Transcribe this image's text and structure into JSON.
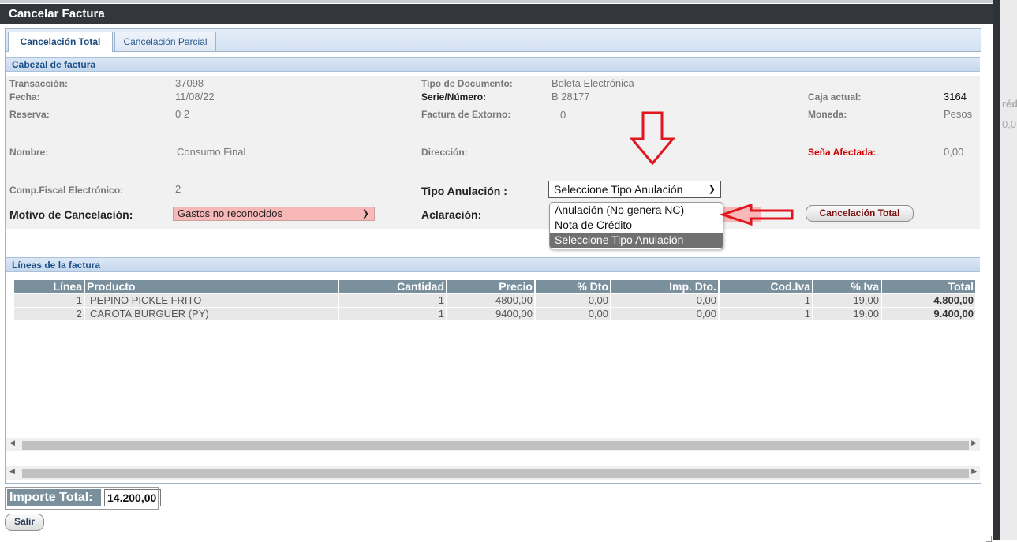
{
  "window": {
    "title": "Cancelar Factura"
  },
  "background": {
    "ghost_text_1": "réd",
    "ghost_text_2": "0,0"
  },
  "tabs": [
    {
      "label": "Cancelación Total",
      "active": true
    },
    {
      "label": "Cancelación Parcial",
      "active": false
    }
  ],
  "header_section": {
    "title": "Cabezal de factura",
    "transaccion_label": "Transacción:",
    "transaccion_value": "37098",
    "fecha_label": "Fecha:",
    "fecha_value": "11/08/22",
    "reserva_label": "Reserva:",
    "reserva_value": "0  2",
    "nombre_label": "Nombre:",
    "nombre_value": "Consumo Final",
    "comp_fiscal_label": "Comp.Fiscal Electrónico:",
    "comp_fiscal_value": "2",
    "motivo_label": "Motivo de Cancelación:",
    "motivo_value": "Gastos no reconocidos",
    "tipo_doc_label": "Tipo de Documento:",
    "tipo_doc_value": "Boleta Electrónica",
    "serie_label": "Serie/Número:",
    "serie_value": "B  28177",
    "extorno_label": "Factura de Extorno:",
    "extorno_value": "0",
    "direccion_label": "Dirección:",
    "tipo_anulacion_label": "Tipo Anulación :",
    "tipo_anulacion_value": "Seleccione Tipo Anulación",
    "aclaracion_label": "Aclaración:",
    "caja_label": "Caja actual:",
    "caja_value": "3164",
    "moneda_label": "Moneda:",
    "moneda_value": "Pesos",
    "sena_label": "Seña Afectada:",
    "sena_value": "0,00",
    "cancel_total_button": "Cancelación Total"
  },
  "tipo_anulacion_dropdown": {
    "options": [
      "Anulación (No genera NC)",
      "Nota de Crédito",
      "Seleccione Tipo Anulación"
    ],
    "selected_index": 2
  },
  "lines_section": {
    "title": "Líneas de la factura",
    "columns": [
      "Línea",
      "Producto",
      "Cantidad",
      "Precio",
      "% Dto",
      "Imp. Dto.",
      "Cod.Iva",
      "% Iva",
      "Total"
    ],
    "rows": [
      [
        "1",
        "PEPINO PICKLE FRITO",
        "1",
        "4800,00",
        "0,00",
        "0,00",
        "1",
        "19,00",
        "4.800,00"
      ],
      [
        "2",
        "CAROTA BURGUER (PY)",
        "1",
        "9400,00",
        "0,00",
        "0,00",
        "1",
        "19,00",
        "9.400,00"
      ]
    ]
  },
  "footer": {
    "importe_total_label": "Importe Total:",
    "importe_total_value": "14.200,00",
    "salir_button": "Salir"
  },
  "colors": {
    "titlebar": "#33373c",
    "grid_header": "#7a909d",
    "highlight_field": "#f8b8b8",
    "annotation_arrow": "#e0171f"
  },
  "icons": {
    "select_chevron": "chevron-down-icon",
    "scroll_left": "arrow-left-icon",
    "scroll_right": "arrow-right-icon",
    "annotation_down": "red-arrow-down-icon",
    "annotation_left": "red-arrow-left-icon"
  }
}
